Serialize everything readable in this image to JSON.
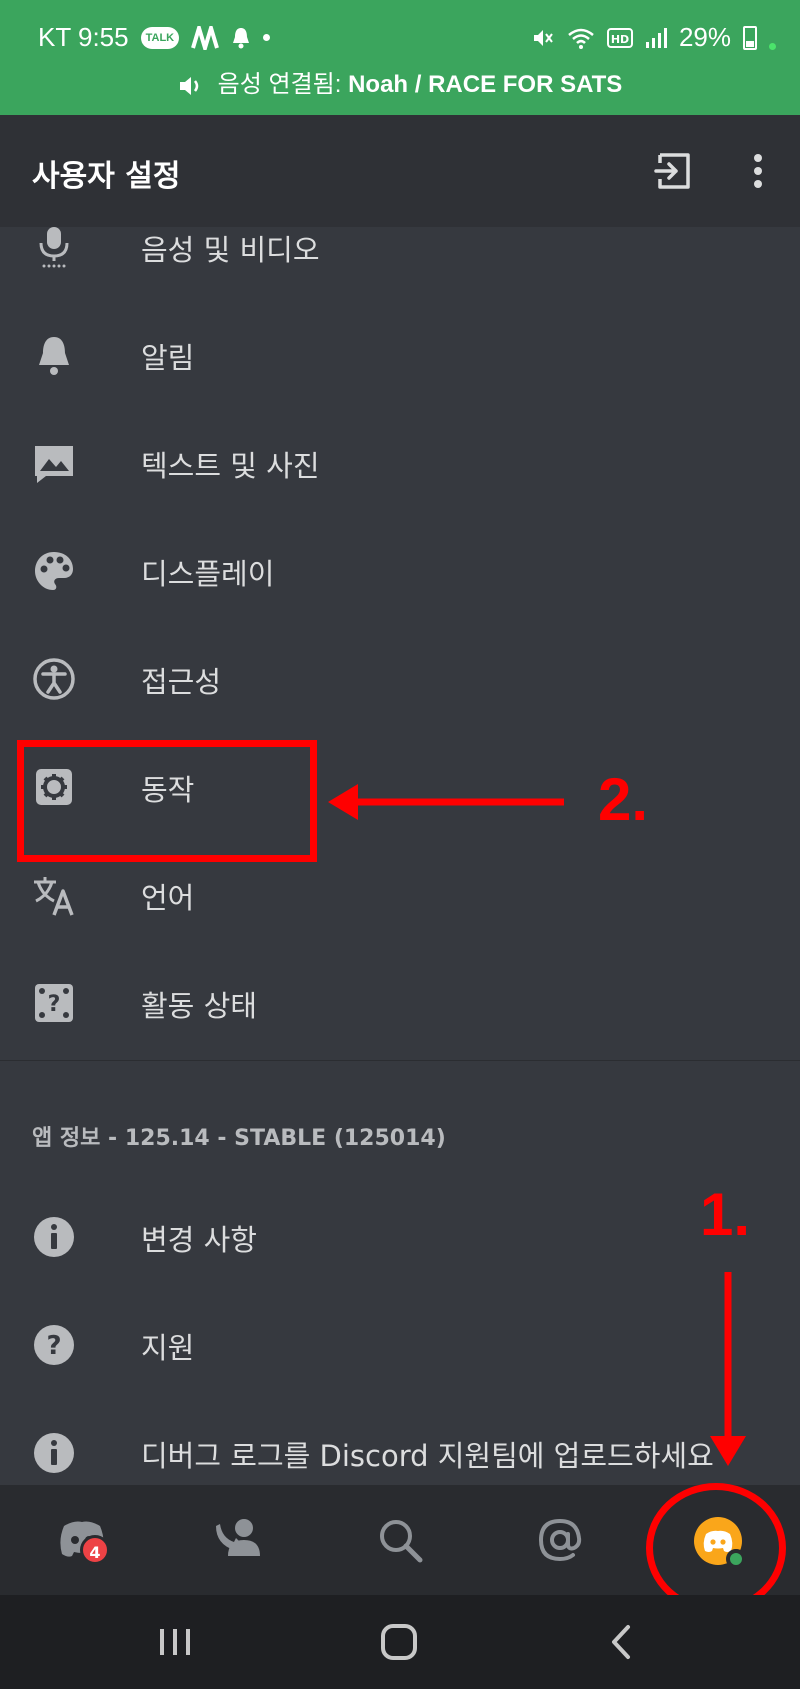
{
  "status_bar": {
    "carrier_time": "KT 9:55",
    "talk_badge": "TALK",
    "battery": "29%"
  },
  "voice_banner": {
    "prefix": "음성 연결됨: ",
    "channel": "Noah / RACE FOR SATS"
  },
  "header": {
    "title": "사용자 설정"
  },
  "menu": {
    "items": [
      {
        "label": "음성 및 비디오",
        "icon": "microphone-icon"
      },
      {
        "label": "알림",
        "icon": "bell-icon"
      },
      {
        "label": "텍스트 및 사진",
        "icon": "image-icon"
      },
      {
        "label": "디스플레이",
        "icon": "palette-icon"
      },
      {
        "label": "접근성",
        "icon": "accessibility-icon"
      },
      {
        "label": "동작",
        "icon": "gear-icon"
      },
      {
        "label": "언어",
        "icon": "translate-icon"
      },
      {
        "label": "활동 상태",
        "icon": "game-status-icon"
      }
    ],
    "app_info_label": "앱 정보 - 125.14 - STABLE (125014)",
    "info_items": [
      {
        "label": "변경 사항",
        "icon": "info-icon"
      },
      {
        "label": "지원",
        "icon": "help-icon"
      },
      {
        "label": "디버그 로그를 Discord 지원팀에 업로드하세요",
        "icon": "info-icon"
      }
    ]
  },
  "annotations": {
    "step1": "1.",
    "step2": "2.",
    "color": "#ff0000"
  },
  "bottom_nav": {
    "home_badge": "4",
    "items": [
      "discord-home-icon",
      "friends-icon",
      "search-icon",
      "mentions-icon",
      "profile-avatar"
    ]
  },
  "colors": {
    "status_green": "#3ba55d",
    "background": "#36393f",
    "header": "#2f3136",
    "bottom_nav": "#292b2f",
    "avatar": "#faa61a",
    "online": "#3ba55d"
  }
}
